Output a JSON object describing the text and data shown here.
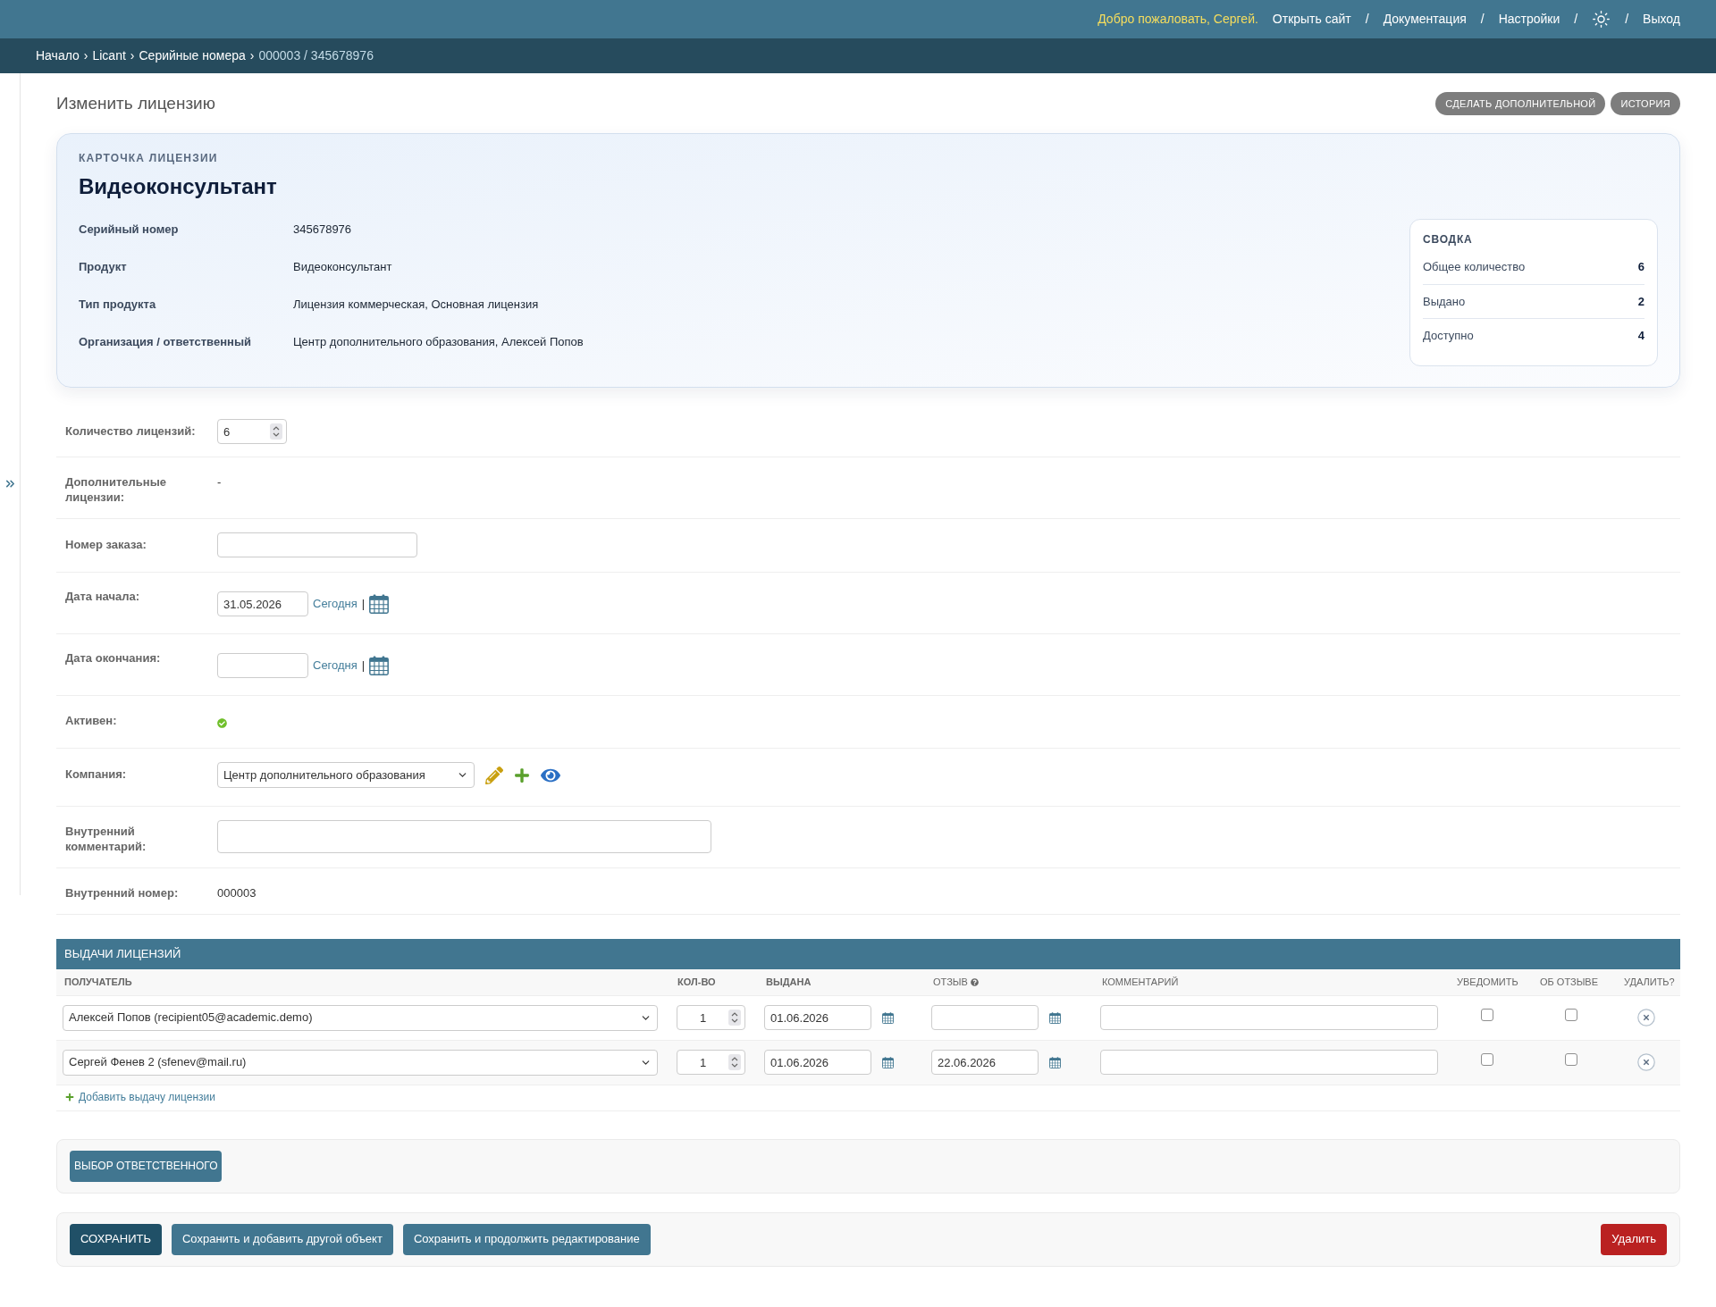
{
  "header": {
    "welcome": "Добро пожаловать, Сергей.",
    "nav": [
      {
        "kind": "link",
        "label": "Открыть сайт"
      },
      {
        "kind": "sep",
        "label": "/"
      },
      {
        "kind": "link",
        "label": "Документация"
      },
      {
        "kind": "sep",
        "label": "/"
      },
      {
        "kind": "link",
        "label": "Настройки"
      },
      {
        "kind": "sep",
        "label": "/"
      },
      {
        "kind": "theme"
      },
      {
        "kind": "sep",
        "label": "/"
      },
      {
        "kind": "link",
        "label": "Выход"
      }
    ]
  },
  "breadcrumbs": [
    {
      "kind": "link",
      "label": "Начало"
    },
    {
      "kind": "sep",
      "label": "›"
    },
    {
      "kind": "link",
      "label": "Licant"
    },
    {
      "kind": "sep",
      "label": "›"
    },
    {
      "kind": "link",
      "label": "Серийные номера"
    },
    {
      "kind": "sep",
      "label": "›"
    },
    {
      "kind": "current",
      "label": "000003 / 345678976"
    }
  ],
  "page_title": "Изменить лицензию",
  "object_tools": [
    "СДЕЛАТЬ ДОПОЛНИТЕЛЬНОЙ",
    "ИСТОРИЯ"
  ],
  "license_card": {
    "eyebrow": "КАРТОЧКА ЛИЦЕНЗИИ",
    "title": "Видеоконсультант",
    "fields": [
      {
        "label": "Серийный номер",
        "value": "345678976"
      },
      {
        "label": "Продукт",
        "value": "Видеоконсультант"
      },
      {
        "label": "Тип продукта",
        "value": "Лицензия коммерческая, Основная лицензия"
      },
      {
        "label": "Организация / ответственный",
        "value": "Центр дополнительного образования, Алексей Попов"
      }
    ],
    "summary": {
      "title": "СВОДКА",
      "rows": [
        {
          "label": "Общее количество",
          "value": "6"
        },
        {
          "label": "Выдано",
          "value": "2"
        },
        {
          "label": "Доступно",
          "value": "4"
        }
      ]
    }
  },
  "form": {
    "rows": [
      {
        "kind": "number",
        "label": "Количество лицензий:",
        "value": "6"
      },
      {
        "kind": "readonly",
        "label": "Дополнительные лицензии:",
        "value": "-"
      },
      {
        "kind": "input",
        "label": "Номер заказа:"
      },
      {
        "kind": "date",
        "label": "Дата начала:",
        "value": "31.05.2026",
        "today": "Сегодня",
        "separator": "|"
      },
      {
        "kind": "date",
        "label": "Дата окончания:",
        "today": "Сегодня",
        "separator": "|"
      },
      {
        "kind": "boolean",
        "label": "Активен:",
        "on": true
      },
      {
        "kind": "select",
        "label": "Компания:",
        "value": "Центр дополнительного образования"
      },
      {
        "kind": "textarea",
        "label": "Внутренний комментарий:"
      },
      {
        "kind": "readonly",
        "label": "Внутренний номер:",
        "value": "000003"
      }
    ]
  },
  "inline": {
    "title": "ВЫДАЧИ ЛИЦЕНЗИЙ",
    "columns": [
      {
        "label": "ПОЛУЧАТЕЛЬ",
        "required": true,
        "help": false
      },
      {
        "label": "КОЛ-ВО",
        "required": true,
        "help": false
      },
      {
        "label": "ВЫДАНА",
        "required": true,
        "help": false
      },
      {
        "label": "ОТЗЫВ",
        "required": false,
        "help": true
      },
      {
        "label": "КОММЕНТАРИЙ",
        "required": false,
        "help": false
      },
      {
        "label": "УВЕДОМИТЬ",
        "required": false,
        "help": false
      },
      {
        "label": "ОБ ОТЗЫВЕ",
        "required": false,
        "help": false
      },
      {
        "label": "УДАЛИТЬ?",
        "required": false,
        "help": false
      }
    ],
    "rows": [
      {
        "recipient": "Алексей Попов (recipient05@academic.demo)",
        "quantity": "1",
        "issued": "01.06.2026",
        "notify": false,
        "notify_revoke": false
      },
      {
        "recipient": "Сергей Фенев 2 (sfenev@mail.ru)",
        "quantity": "1",
        "issued": "01.06.2026",
        "revoked": "22.06.2026",
        "notify": false,
        "notify_revoke": false
      }
    ],
    "add_link": "Добавить выдачу лицензии"
  },
  "responsible_button": "ВЫБОР ОТВЕТСТВЕННОГО",
  "submit_row": [
    {
      "kind": "primary",
      "label": "СОХРАНИТЬ"
    },
    {
      "kind": "default",
      "label": "Сохранить и добавить другой объект"
    },
    {
      "kind": "default",
      "label": "Сохранить и продолжить редактирование"
    },
    {
      "kind": "danger",
      "label": "Удалить"
    }
  ]
}
